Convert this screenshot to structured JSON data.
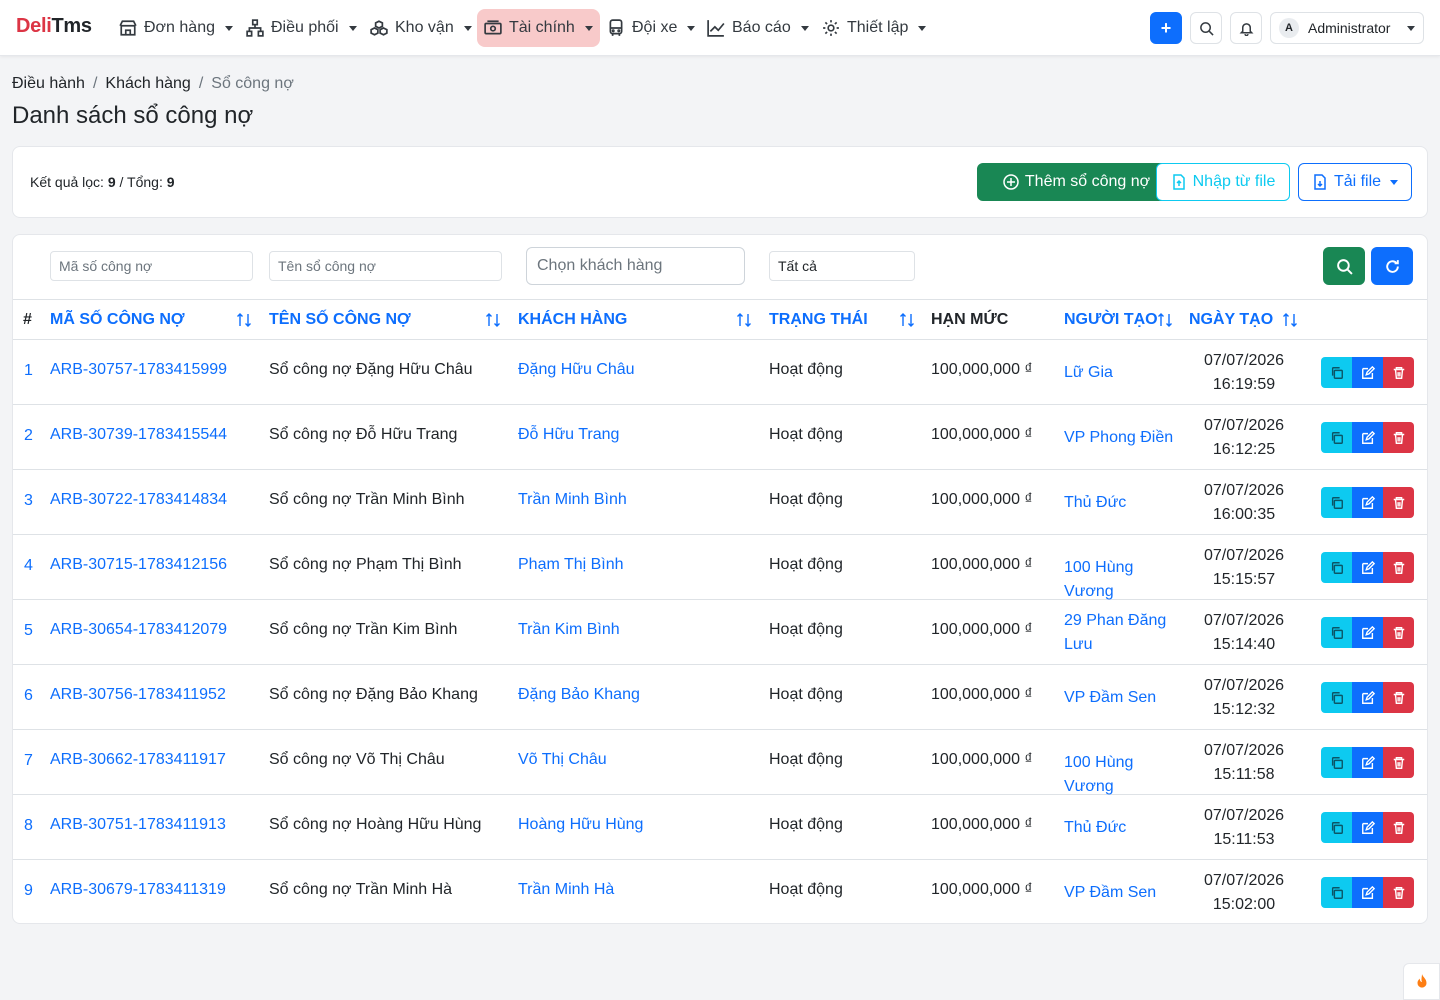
{
  "brand": {
    "part1": "Deli",
    "part2": "Tms"
  },
  "nav": [
    {
      "label": "Đơn hàng",
      "icon": "store-icon"
    },
    {
      "label": "Điều phối",
      "icon": "network-icon"
    },
    {
      "label": "Kho vận",
      "icon": "boxes-icon"
    },
    {
      "label": "Tài chính",
      "icon": "cash-icon",
      "active": true
    },
    {
      "label": "Đội xe",
      "icon": "bus-icon"
    },
    {
      "label": "Báo cáo",
      "icon": "chart-line-icon"
    },
    {
      "label": "Thiết lập",
      "icon": "gear-icon"
    }
  ],
  "header_right": {
    "add_symbol": "+",
    "user_initial": "A",
    "user_name": "Administrator"
  },
  "breadcrumb": {
    "item1": "Điều hành",
    "item2": "Khách hàng",
    "current": "Sổ công nợ",
    "sep": "/"
  },
  "page_title": "Danh sách sổ công nợ",
  "summary": {
    "filter_label": "Kết quả lọc:",
    "filter_count": "9",
    "total_label": "/ Tổng:",
    "total_count": "9"
  },
  "actions": {
    "add": "Thêm sổ công nợ",
    "import": "Nhập từ file",
    "download": "Tải file"
  },
  "filters": {
    "code_placeholder": "Mã số công nợ",
    "name_placeholder": "Tên sổ công nợ",
    "customer_placeholder": "Chọn khách hàng",
    "status_value": "Tất cả"
  },
  "columns": {
    "index": "#",
    "code": "MÃ SỐ CÔNG NỢ",
    "name": "TÊN SỐ CÔNG NỢ",
    "customer": "KHÁCH HÀNG",
    "status": "TRẠNG THÁI",
    "limit": "HẠN MỨC",
    "creator": "NGƯỜI TẠO",
    "created": "NGÀY TẠO"
  },
  "rows": [
    {
      "no": "1",
      "code": "ARB-30757-1783415999",
      "name": "Sổ công nợ Đặng Hữu Châu",
      "customer": "Đặng Hữu Châu",
      "status": "Hoạt động",
      "limit": "100,000,000 ₫",
      "creator": "Lữ Gia",
      "date": "07/07/2026",
      "time": "16:19:59"
    },
    {
      "no": "2",
      "code": "ARB-30739-1783415544",
      "name": "Sổ công nợ Đỗ Hữu Trang",
      "customer": "Đỗ Hữu Trang",
      "status": "Hoạt động",
      "limit": "100,000,000 ₫",
      "creator": "VP Phong Điền",
      "date": "07/07/2026",
      "time": "16:12:25"
    },
    {
      "no": "3",
      "code": "ARB-30722-1783414834",
      "name": "Sổ công nợ Trần Minh Bình",
      "customer": "Trần Minh Bình",
      "status": "Hoạt động",
      "limit": "100,000,000 ₫",
      "creator": "Thủ Đức",
      "date": "07/07/2026",
      "time": "16:00:35"
    },
    {
      "no": "4",
      "code": "ARB-30715-1783412156",
      "name": "Sổ công nợ Phạm Thị Bình",
      "customer": "Phạm Thị Bình",
      "status": "Hoạt động",
      "limit": "100,000,000 ₫",
      "creator": "100 Hùng Vương",
      "date": "07/07/2026",
      "time": "15:15:57"
    },
    {
      "no": "5",
      "code": "ARB-30654-1783412079",
      "name": "Sổ công nợ Trần Kim Bình",
      "customer": "Trần Kim Bình",
      "status": "Hoạt động",
      "limit": "100,000,000 ₫",
      "creator": "29 Phan Đăng Lưu",
      "date": "07/07/2026",
      "time": "15:14:40"
    },
    {
      "no": "6",
      "code": "ARB-30756-1783411952",
      "name": "Sổ công nợ Đặng Bảo Khang",
      "customer": "Đặng Bảo Khang",
      "status": "Hoạt động",
      "limit": "100,000,000 ₫",
      "creator": "VP Đầm Sen",
      "date": "07/07/2026",
      "time": "15:12:32"
    },
    {
      "no": "7",
      "code": "ARB-30662-1783411917",
      "name": "Sổ công nợ Võ Thị Châu",
      "customer": "Võ Thị Châu",
      "status": "Hoạt động",
      "limit": "100,000,000 ₫",
      "creator": "100 Hùng Vương",
      "date": "07/07/2026",
      "time": "15:11:58"
    },
    {
      "no": "8",
      "code": "ARB-30751-1783411913",
      "name": "Sổ công nợ Hoàng Hữu Hùng",
      "customer": "Hoàng Hữu Hùng",
      "status": "Hoạt động",
      "limit": "100,000,000 ₫",
      "creator": "Thủ Đức",
      "date": "07/07/2026",
      "time": "15:11:53"
    },
    {
      "no": "9",
      "code": "ARB-30679-1783411319",
      "name": "Sổ công nợ Trần Minh Hà",
      "customer": "Trần Minh Hà",
      "status": "Hoạt động",
      "limit": "100,000,000 ₫",
      "creator": "VP Đầm Sen",
      "date": "07/07/2026",
      "time": "15:02:00"
    }
  ],
  "colors": {
    "primary": "#0d6efd",
    "success": "#198754",
    "info": "#0dcaf0",
    "danger": "#dc3545",
    "active_nav": "#f8caca"
  }
}
